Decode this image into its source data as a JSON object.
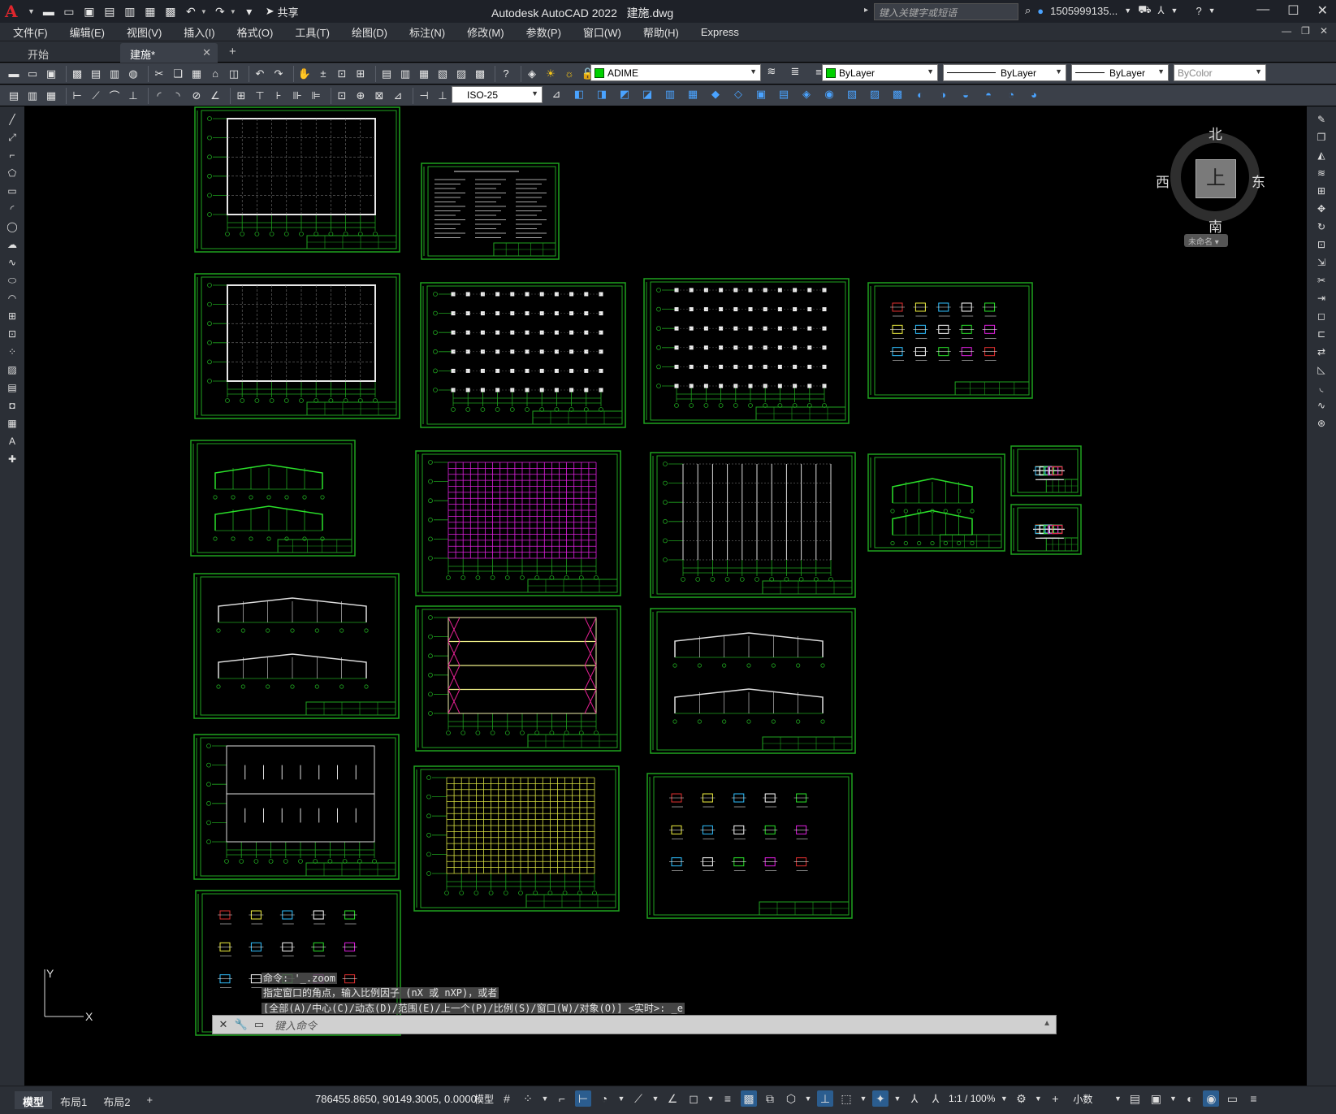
{
  "titlebar": {
    "app_title": "Autodesk AutoCAD 2022",
    "file_name": "建施.dwg",
    "share_label": "共享",
    "search_placeholder": "键入关键字或短语",
    "user": "1505999135...",
    "logo": "A"
  },
  "menu": [
    "文件(F)",
    "编辑(E)",
    "视图(V)",
    "插入(I)",
    "格式(O)",
    "工具(T)",
    "绘图(D)",
    "标注(N)",
    "修改(M)",
    "参数(P)",
    "窗口(W)",
    "帮助(H)",
    "Express"
  ],
  "tabs": {
    "start": "开始",
    "active": "建施*"
  },
  "properties": {
    "layer": "ADIME",
    "color": "ByLayer",
    "linetype": "ByLayer",
    "lineweight": "ByLayer",
    "plotstyle": "ByColor",
    "dimstyle": "ISO-25",
    "layer_color": "#00d000"
  },
  "viewcube": {
    "north": "北",
    "south": "南",
    "east": "东",
    "west": "西",
    "face": "上",
    "wcs": "未命名"
  },
  "ucs": {
    "x": "X",
    "y": "Y"
  },
  "command": {
    "line1": "命令: '_.zoom",
    "line2": "指定窗口的角点，输入比例因子 (nX 或 nXP)，或者",
    "line3": "[全部(A)/中心(C)/动态(D)/范围(E)/上一个(P)/比例(S)/窗口(W)/对象(O)] <实时>: _e",
    "placeholder": "键入命令"
  },
  "layout_tabs": [
    "模型",
    "布局1",
    "布局2"
  ],
  "status": {
    "coords": "786455.8650, 90149.3005, 0.0000",
    "model": "模型",
    "scale": "1:1 / 100%",
    "units": "小数"
  }
}
